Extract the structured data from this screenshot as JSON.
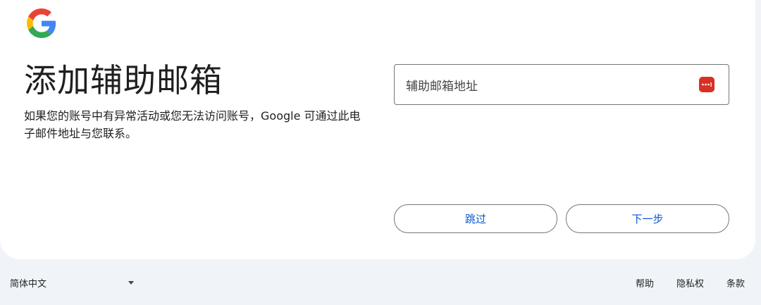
{
  "page": {
    "title": "添加辅助邮箱",
    "description": "如果您的账号中有异常活动或您无法访问账号，Google 可通过此电子邮件地址与您联系。"
  },
  "logo": {
    "name": "google-logo"
  },
  "form": {
    "email_label": "辅助邮箱地址",
    "email_value": ""
  },
  "actions": {
    "skip_label": "跳过",
    "next_label": "下一步"
  },
  "footer": {
    "language": "简体中文",
    "links": [
      "帮助",
      "隐私权",
      "条款"
    ]
  },
  "colors": {
    "accent": "#0b57d0",
    "page_background": "#f0f4f9",
    "card_background": "#ffffff",
    "password_manager_icon": "#d93025"
  },
  "icons": {
    "logo": "google-g-icon",
    "field_icon": "password-manager-icon",
    "language_dropdown": "caret-down-icon"
  }
}
